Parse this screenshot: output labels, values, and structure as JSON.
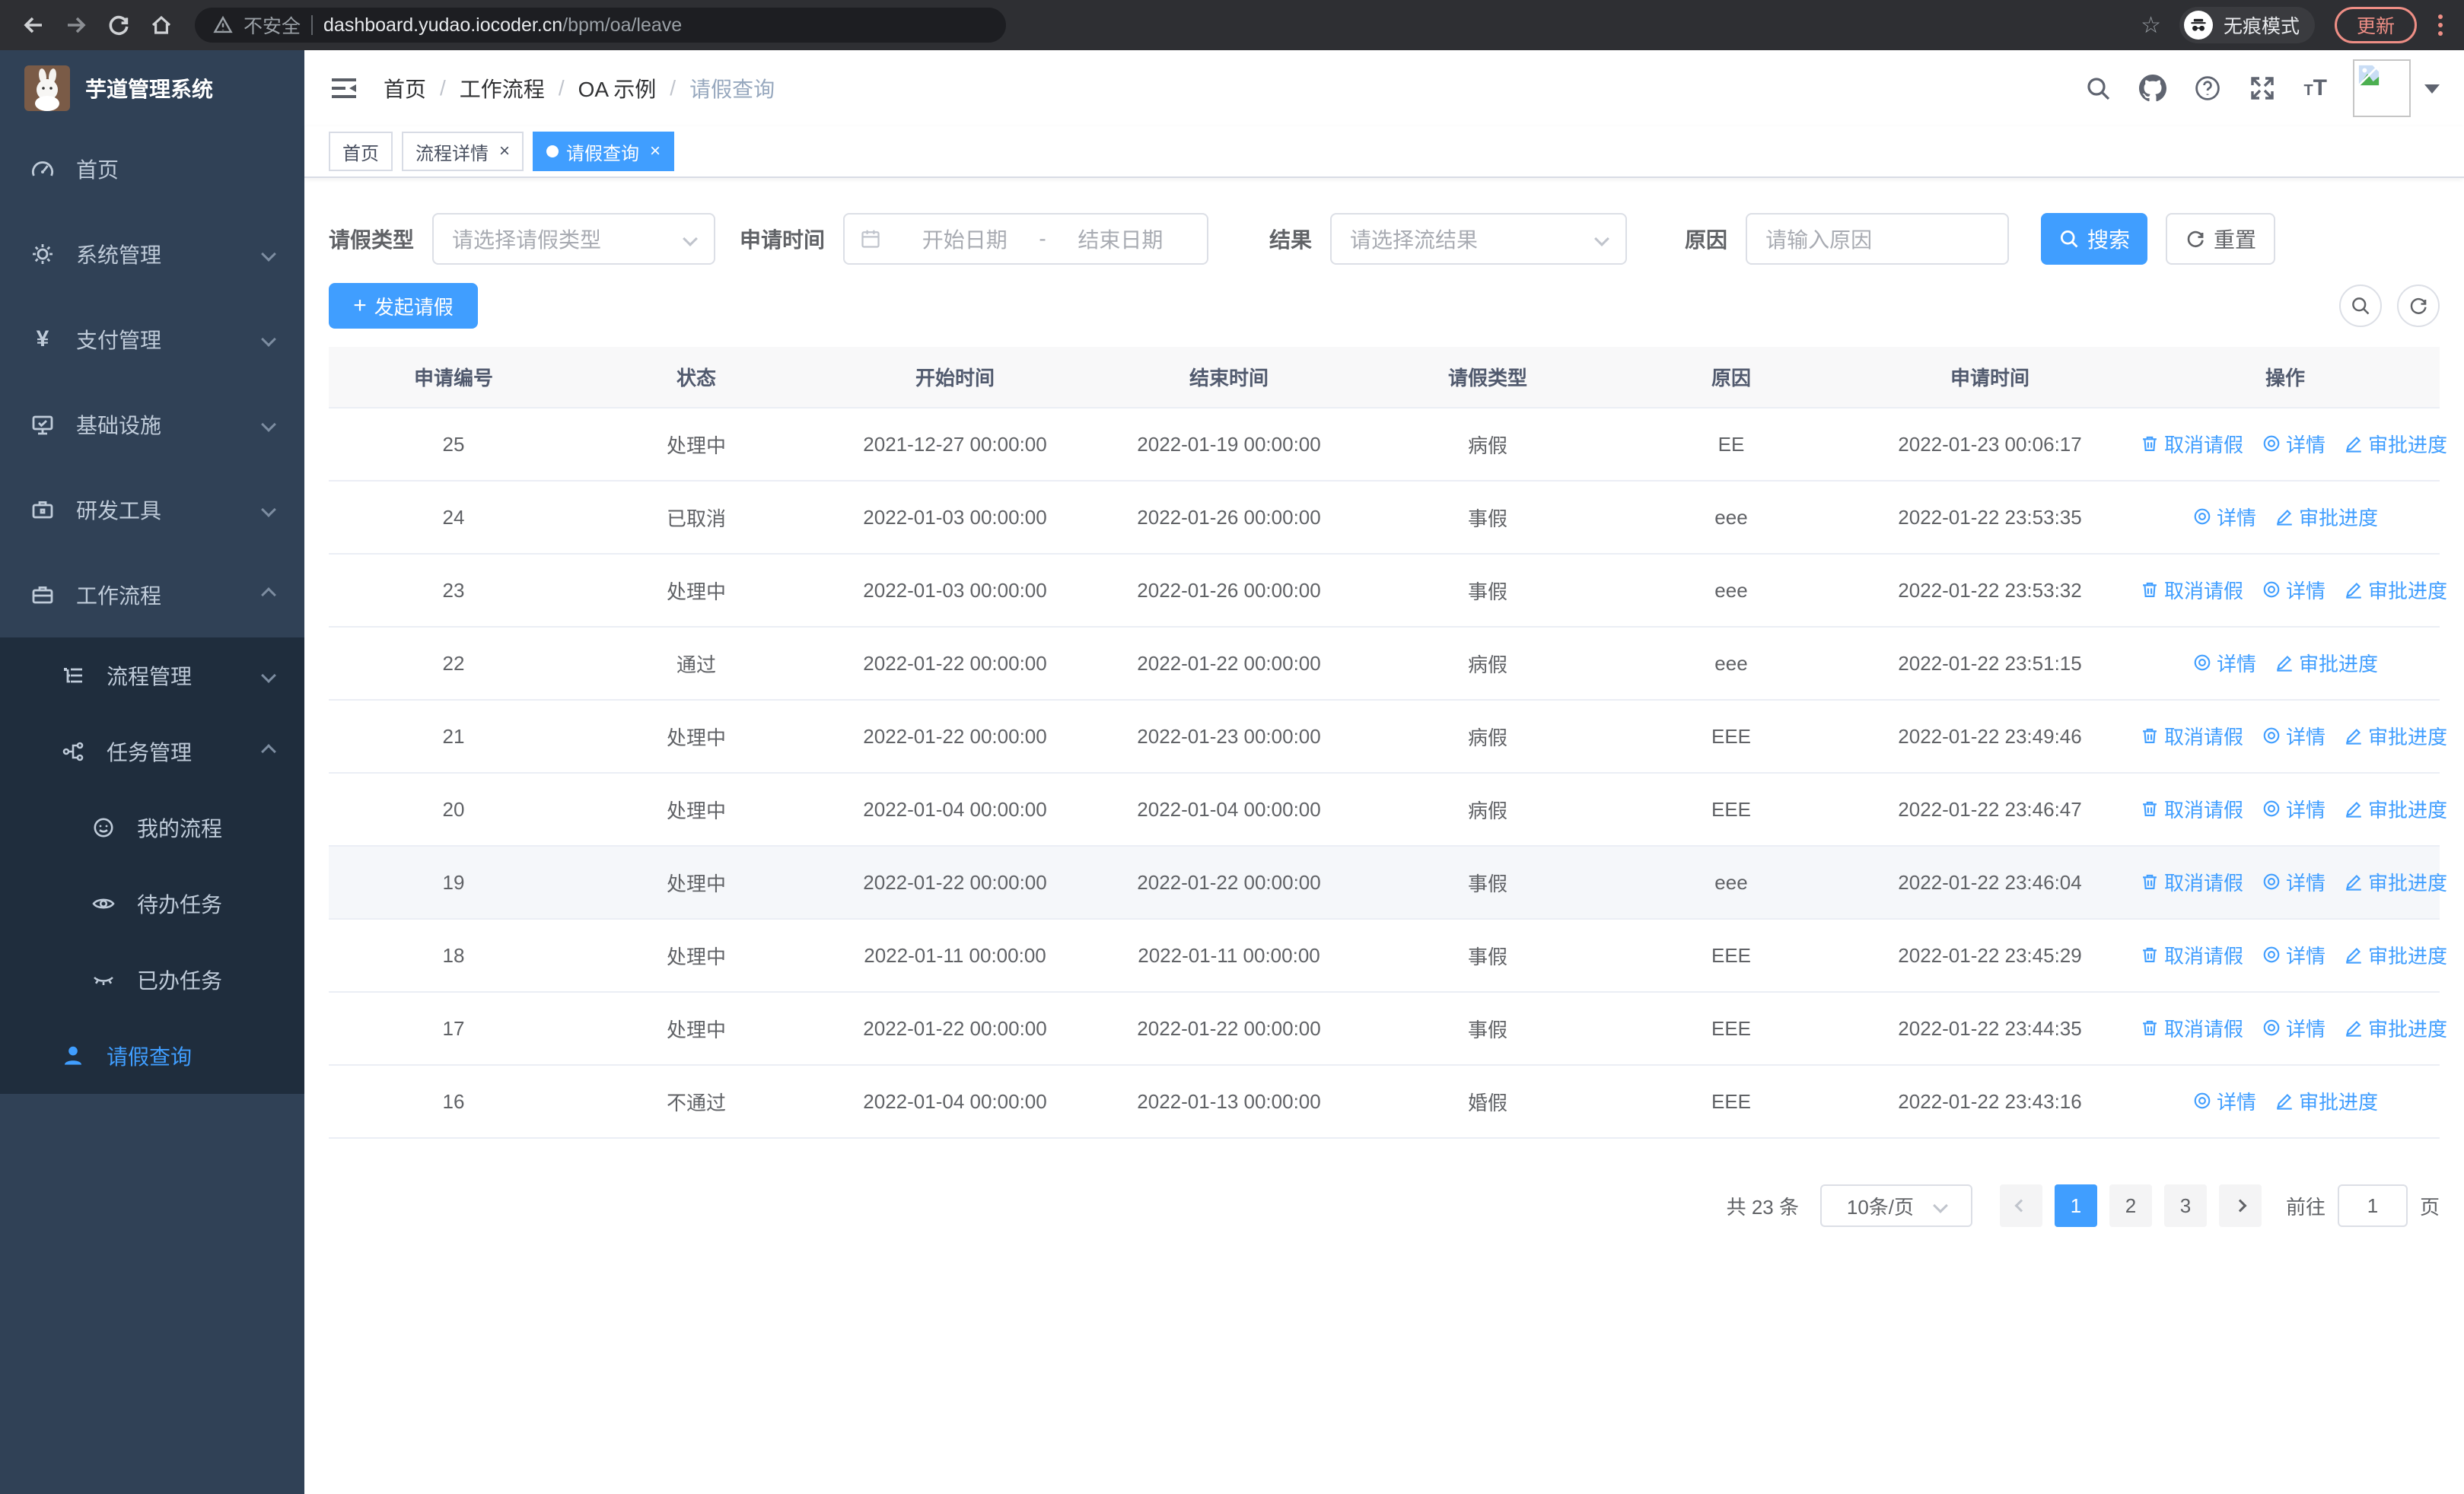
{
  "colors": {
    "accent": "#409eff",
    "sidebar_bg": "#304156",
    "sidebar_sub_bg": "#1f2d3d",
    "update_pill": "#ee8e85"
  },
  "browser": {
    "security_label": "不安全",
    "url_host": "dashboard.yudao.iocoder.cn",
    "url_path": "/bpm/oa/leave",
    "incognito_label": "无痕模式",
    "update_label": "更新"
  },
  "sidebar": {
    "logo_title": "芋道管理系统",
    "items": [
      {
        "label": "首页"
      },
      {
        "label": "系统管理"
      },
      {
        "label": "支付管理"
      },
      {
        "label": "基础设施"
      },
      {
        "label": "研发工具"
      },
      {
        "label": "工作流程"
      }
    ],
    "sub_items": [
      {
        "label": "流程管理"
      },
      {
        "label": "任务管理"
      },
      {
        "label": "我的流程"
      },
      {
        "label": "待办任务"
      },
      {
        "label": "已办任务"
      },
      {
        "label": "请假查询"
      }
    ]
  },
  "navbar": {
    "breadcrumb": [
      {
        "label": "首页"
      },
      {
        "label": "工作流程"
      },
      {
        "label": "OA 示例"
      },
      {
        "label": "请假查询"
      }
    ]
  },
  "tabs": [
    {
      "label": "首页"
    },
    {
      "label": "流程详情"
    },
    {
      "label": "请假查询"
    }
  ],
  "filters": {
    "leave_type_label": "请假类型",
    "leave_type_placeholder": "请选择请假类型",
    "apply_time_label": "申请时间",
    "start_date_placeholder": "开始日期",
    "date_separator": "-",
    "end_date_placeholder": "结束日期",
    "result_label": "结果",
    "result_placeholder": "请选择流结果",
    "reason_label": "原因",
    "reason_placeholder": "请输入原因",
    "search_label": "搜索",
    "reset_label": "重置"
  },
  "toolbar": {
    "create_label": "发起请假"
  },
  "table": {
    "columns": [
      "申请编号",
      "状态",
      "开始时间",
      "结束时间",
      "请假类型",
      "原因",
      "申请时间",
      "操作"
    ],
    "op_labels": {
      "cancel": "取消请假",
      "detail": "详情",
      "progress": "审批进度"
    },
    "rows": [
      {
        "id": "25",
        "status": "处理中",
        "start": "2021-12-27 00:00:00",
        "end": "2022-01-19 00:00:00",
        "type": "病假",
        "reason": "EE",
        "applied": "2022-01-23 00:06:17",
        "ops": [
          "cancel",
          "detail",
          "progress"
        ],
        "highlight": false
      },
      {
        "id": "24",
        "status": "已取消",
        "start": "2022-01-03 00:00:00",
        "end": "2022-01-26 00:00:00",
        "type": "事假",
        "reason": "eee",
        "applied": "2022-01-22 23:53:35",
        "ops": [
          "detail",
          "progress"
        ],
        "highlight": false
      },
      {
        "id": "23",
        "status": "处理中",
        "start": "2022-01-03 00:00:00",
        "end": "2022-01-26 00:00:00",
        "type": "事假",
        "reason": "eee",
        "applied": "2022-01-22 23:53:32",
        "ops": [
          "cancel",
          "detail",
          "progress"
        ],
        "highlight": false
      },
      {
        "id": "22",
        "status": "通过",
        "start": "2022-01-22 00:00:00",
        "end": "2022-01-22 00:00:00",
        "type": "病假",
        "reason": "eee",
        "applied": "2022-01-22 23:51:15",
        "ops": [
          "detail",
          "progress"
        ],
        "highlight": false
      },
      {
        "id": "21",
        "status": "处理中",
        "start": "2022-01-22 00:00:00",
        "end": "2022-01-23 00:00:00",
        "type": "病假",
        "reason": "EEE",
        "applied": "2022-01-22 23:49:46",
        "ops": [
          "cancel",
          "detail",
          "progress"
        ],
        "highlight": false
      },
      {
        "id": "20",
        "status": "处理中",
        "start": "2022-01-04 00:00:00",
        "end": "2022-01-04 00:00:00",
        "type": "病假",
        "reason": "EEE",
        "applied": "2022-01-22 23:46:47",
        "ops": [
          "cancel",
          "detail",
          "progress"
        ],
        "highlight": false
      },
      {
        "id": "19",
        "status": "处理中",
        "start": "2022-01-22 00:00:00",
        "end": "2022-01-22 00:00:00",
        "type": "事假",
        "reason": "eee",
        "applied": "2022-01-22 23:46:04",
        "ops": [
          "cancel",
          "detail",
          "progress"
        ],
        "highlight": true
      },
      {
        "id": "18",
        "status": "处理中",
        "start": "2022-01-11 00:00:00",
        "end": "2022-01-11 00:00:00",
        "type": "事假",
        "reason": "EEE",
        "applied": "2022-01-22 23:45:29",
        "ops": [
          "cancel",
          "detail",
          "progress"
        ],
        "highlight": false
      },
      {
        "id": "17",
        "status": "处理中",
        "start": "2022-01-22 00:00:00",
        "end": "2022-01-22 00:00:00",
        "type": "事假",
        "reason": "EEE",
        "applied": "2022-01-22 23:44:35",
        "ops": [
          "cancel",
          "detail",
          "progress"
        ],
        "highlight": false
      },
      {
        "id": "16",
        "status": "不通过",
        "start": "2022-01-04 00:00:00",
        "end": "2022-01-13 00:00:00",
        "type": "婚假",
        "reason": "EEE",
        "applied": "2022-01-22 23:43:16",
        "ops": [
          "detail",
          "progress"
        ],
        "highlight": false
      }
    ]
  },
  "pagination": {
    "total_label": "共 23 条",
    "page_size": "10条/页",
    "pages": [
      "1",
      "2",
      "3"
    ],
    "active_page": "1",
    "goto_label": "前往",
    "goto_value": "1",
    "page_unit": "页"
  }
}
